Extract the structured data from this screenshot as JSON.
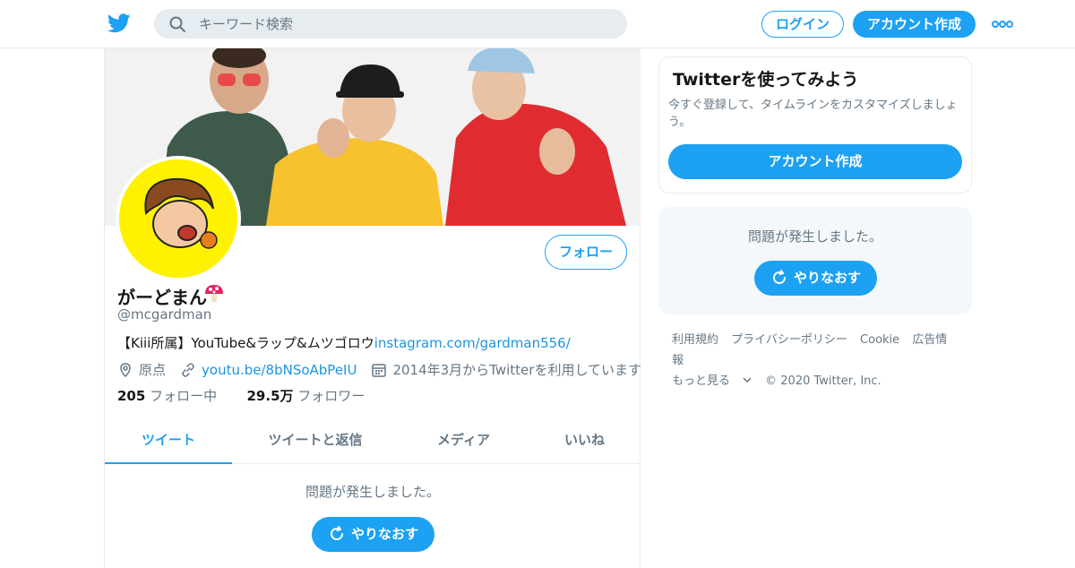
{
  "search": {
    "placeholder": "キーワード検索"
  },
  "header": {
    "login_label": "ログイン",
    "signup_label": "アカウント作成"
  },
  "profile": {
    "name": "がーどまん",
    "handle": "@mcgardman",
    "bio_text": "【Kiii所属】YouTube&ラップ&ムツゴロウ",
    "bio_link": "instagram.com/gardman556/",
    "location": "原点",
    "website": "youtu.be/8bNSoAbPeIU",
    "joined": "2014年3月からTwitterを利用しています",
    "following_count": "205",
    "following_label": "フォロー中",
    "followers_count": "29.5万",
    "followers_label": "フォロワー",
    "follow_button": "フォロー"
  },
  "tabs": [
    {
      "label": "ツイート",
      "active": true
    },
    {
      "label": "ツイートと返信",
      "active": false
    },
    {
      "label": "メディア",
      "active": false
    },
    {
      "label": "いいね",
      "active": false
    }
  ],
  "timeline": {
    "error_text": "問題が発生しました。",
    "retry_label": "やりなおす"
  },
  "sidebar": {
    "card_title": "Twitterを使ってみよう",
    "card_desc": "今すぐ登録して、タイムラインをカスタマイズしましょう。",
    "card_button": "アカウント作成",
    "error_text": "問題が発生しました。",
    "retry_label": "やりなおす"
  },
  "footer": {
    "links": [
      "利用規約",
      "プライバシーポリシー",
      "Cookie",
      "広告情報"
    ],
    "more_label": "もっと見る",
    "copyright": "© 2020 Twitter, Inc."
  },
  "colors": {
    "accent": "#1da1f2",
    "text": "#14171a",
    "muted": "#657786",
    "link": "#1b95e0"
  }
}
